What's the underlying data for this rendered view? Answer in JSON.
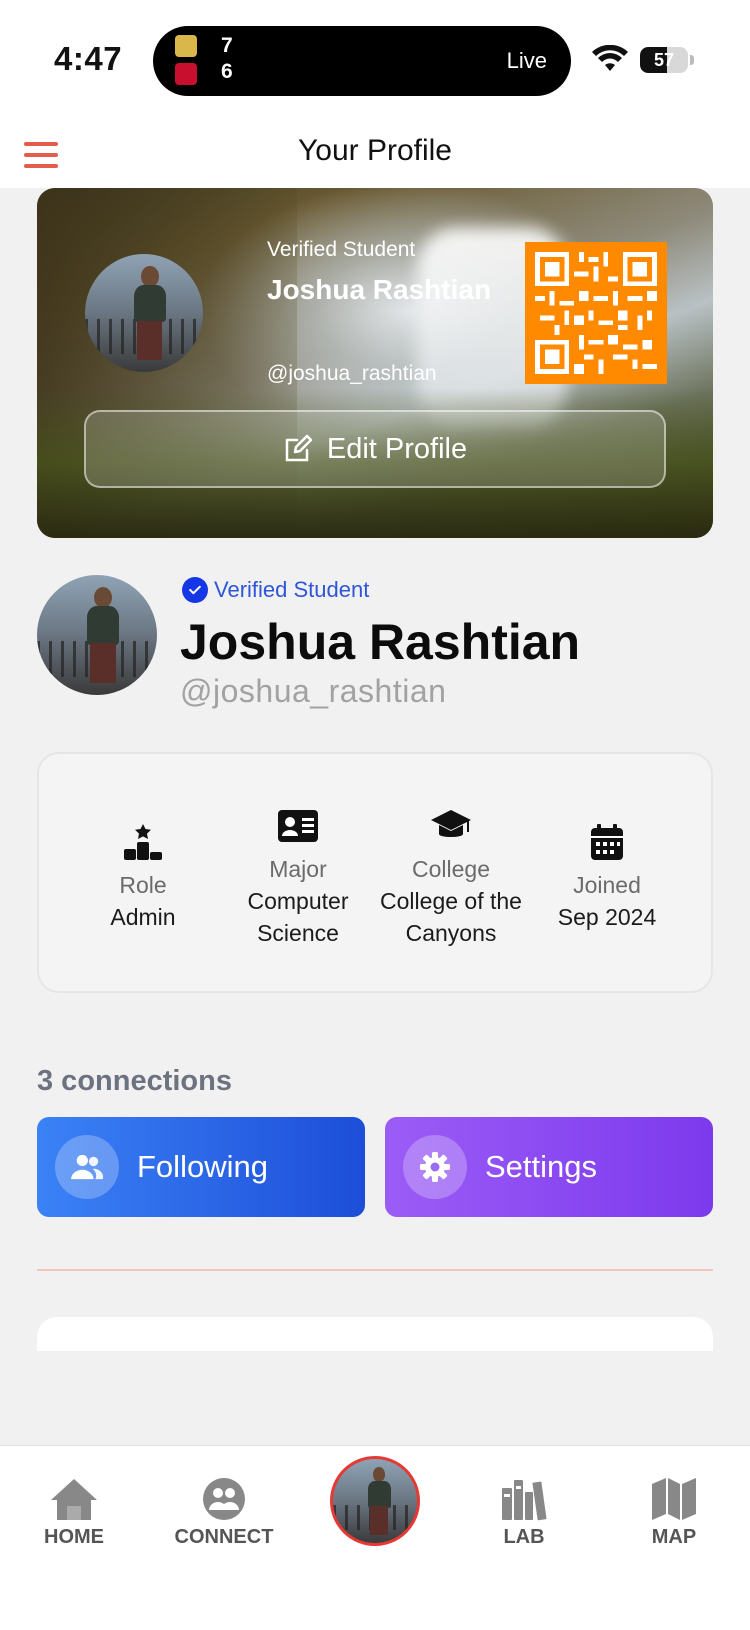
{
  "status_bar": {
    "time": "4:47",
    "live_activity": {
      "score_top": "7",
      "score_bottom": "6",
      "label": "Live"
    },
    "battery_level": "57",
    "battery_fraction": 0.57
  },
  "header": {
    "title": "Your Profile",
    "menu_icon": "hamburger-menu-icon"
  },
  "profile_card": {
    "verified_label": "Verified Student",
    "name": "Joshua Rashtian",
    "handle": "@joshua_rashtian",
    "edit_button": "Edit Profile",
    "qr_color": "#ff8a00"
  },
  "identity": {
    "verified_label": "Verified Student",
    "name": "Joshua Rashtian",
    "handle": "@joshua_rashtian",
    "verified_color": "#1637e6"
  },
  "info": {
    "role": {
      "label": "Role",
      "value": "Admin",
      "icon": "podium-icon"
    },
    "major": {
      "label": "Major",
      "value": "Computer Science",
      "icon": "id-card-icon"
    },
    "college": {
      "label": "College",
      "value": "College of the Canyons",
      "icon": "graduation-cap-icon"
    },
    "joined": {
      "label": "Joined",
      "value": "Sep 2024",
      "icon": "calendar-icon"
    }
  },
  "connections": {
    "count_text": "3 connections",
    "following_button": "Following",
    "settings_button": "Settings",
    "following_color": "#2563eb",
    "settings_color": "#8b5cf6"
  },
  "tabbar": {
    "home": "HOME",
    "connect": "CONNECT",
    "lab": "LAB",
    "map": "MAP",
    "active_color": "#e53935"
  }
}
